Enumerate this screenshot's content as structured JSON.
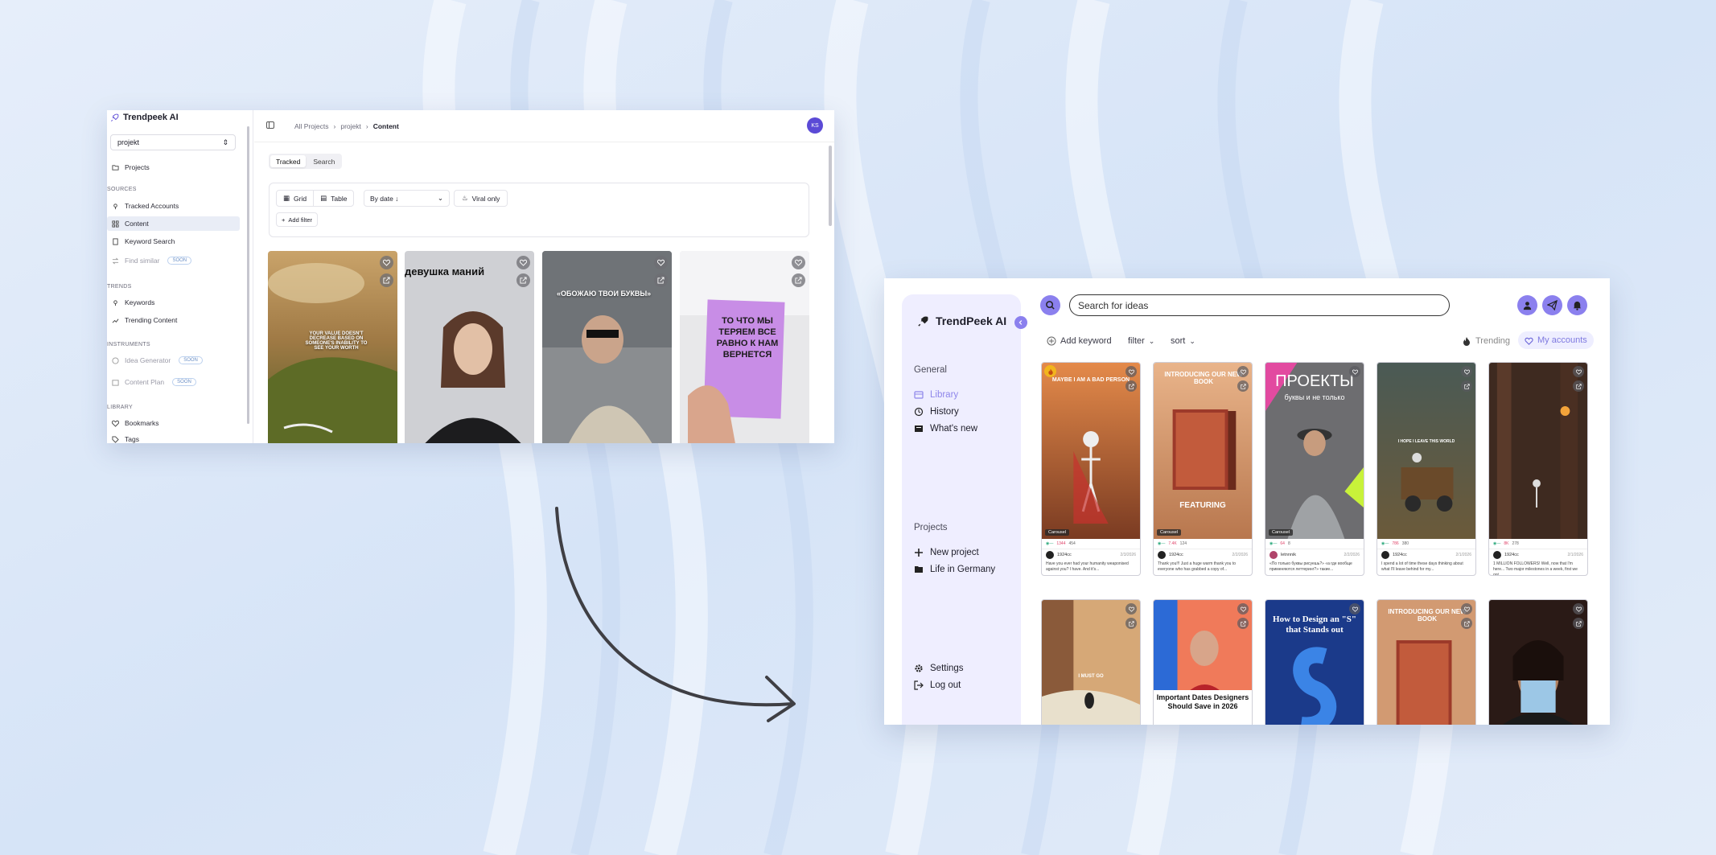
{
  "old_app": {
    "brand": "Trendpeek AI",
    "project_select": "projekt",
    "nav": {
      "projects": "Projects",
      "sources_label": "SOURCES",
      "tracked_accounts": "Tracked Accounts",
      "content": "Content",
      "keyword_search": "Keyword Search",
      "find_similar": "Find similar",
      "trends_label": "TRENDS",
      "keywords": "Keywords",
      "trending_content": "Trending Content",
      "instruments_label": "INSTRUMENTS",
      "idea_generator": "Idea Generator",
      "content_plan": "Content Plan",
      "library_label": "LIBRARY",
      "bookmarks": "Bookmarks",
      "tags": "Tags",
      "soon_badge": "SOON"
    },
    "breadcrumb": {
      "all_projects": "All Projects",
      "project": "projekt",
      "current": "Content"
    },
    "avatar_initials": "KS",
    "tabs": {
      "tracked": "Tracked",
      "search": "Search"
    },
    "filters": {
      "grid": "Grid",
      "table": "Table",
      "sort": "By date ↓",
      "viral_only": "Viral only",
      "add_filter": "Add filter"
    },
    "cards": [
      {
        "overlay": "YOUR VALUE DOESN'T DECREASE BASED ON SOMEONE'S INABILITY TO SEE YOUR WORTH"
      },
      {
        "overlay": "девушка маний"
      },
      {
        "overlay": "«ОБОЖАЮ ТВОИ БУКВЫ»"
      },
      {
        "overlay": "ТО ЧТО МЫ ТЕРЯЕМ ВСЕ РАВНО К НАМ ВЕРНЕТСЯ"
      }
    ]
  },
  "new_app": {
    "brand": "TrendPeek AI",
    "search_placeholder": "Search for ideas",
    "general_label": "General",
    "nav": {
      "library": "Library",
      "history": "History",
      "whats_new": "What's new"
    },
    "projects_label": "Projects",
    "projects": {
      "new_project": "New project",
      "life_in_germany": "Life in Germany"
    },
    "settings": "Settings",
    "logout": "Log out",
    "toolbar": {
      "add_keyword": "Add keyword",
      "filter": "filter",
      "sort": "sort",
      "trending": "Trending",
      "my_accounts": "My accounts"
    },
    "carousel_tag": "Carousel",
    "cards_row1": [
      {
        "overlay": "MAYBE I AM A BAD PERSON",
        "author": "1924cc",
        "date": "2/3/2026",
        "likes": "1344",
        "comments": "454",
        "caption": "Have you ever had your humanity weaponised against you? I have. And it's..."
      },
      {
        "overlay": "INTRODUCING OUR NEW BOOK",
        "overlay2": "FEATURING",
        "author": "1924cc",
        "date": "2/2/2026",
        "likes": "7.4K",
        "comments": "124",
        "caption": "Thank you!!! Just a huge warm thank you to everyone who has grabbed a copy of..."
      },
      {
        "overlay": "ПРОЕКТЫ",
        "overlay2": "буквы и не только",
        "author": "letnnnik",
        "date": "2/2/2026",
        "likes": "64",
        "comments": "8",
        "caption": "«По только буквы рисуешь?» «а где вообще применяются леттеринг?» такие..."
      },
      {
        "overlay": "I HOPE I LEAVE THIS WORLD",
        "author": "1924cc",
        "date": "2/1/2026",
        "likes": "786",
        "comments": "380",
        "caption": "I spend a lot of time these days thinking about what I'll leave behind for my..."
      },
      {
        "overlay": "",
        "author": "1924cc",
        "date": "2/1/2026",
        "likes": "8K",
        "comments": "278",
        "caption": "1 MILLION FOLLOWERS! Well, now that I'm here... Two major milestones in a week, first we got..."
      }
    ],
    "cards_row2": [
      {
        "overlay": "I MUST GO"
      },
      {
        "overlay": "Important Dates Designers Should Save in 2026"
      },
      {
        "overlay": "How to Design an \"S\" that Stands out"
      },
      {
        "overlay": "INTRODUCING OUR NEW BOOK"
      },
      {
        "overlay": ""
      }
    ]
  }
}
